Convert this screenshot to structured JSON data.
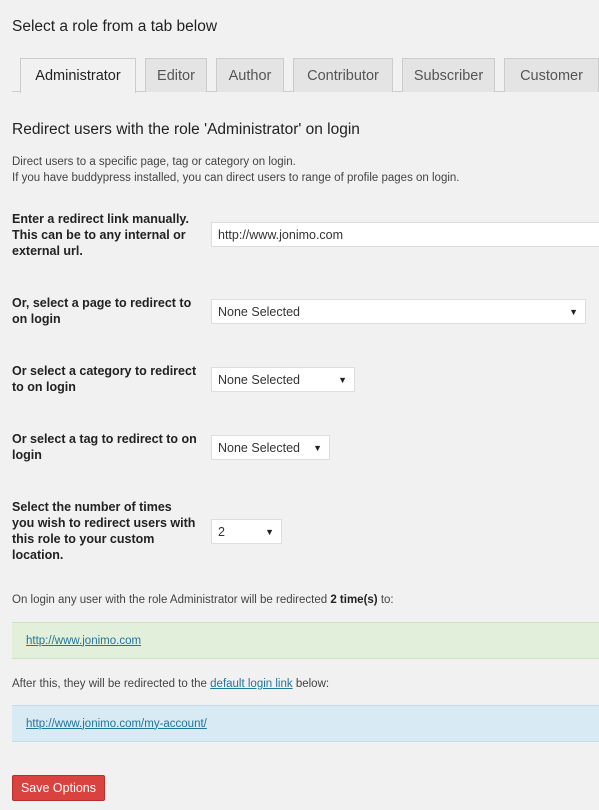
{
  "header": {
    "title": "Select a role from a tab below"
  },
  "tabs": [
    {
      "label": "Administrator",
      "active": true
    },
    {
      "label": "Editor",
      "active": false
    },
    {
      "label": "Author",
      "active": false
    },
    {
      "label": "Contributor",
      "active": false
    },
    {
      "label": "Subscriber",
      "active": false
    },
    {
      "label": "Customer",
      "active": false
    }
  ],
  "section": {
    "title": "Redirect users with the role 'Administrator' on login",
    "desc_line1": "Direct users to a specific page, tag or category on login.",
    "desc_line2": "If you have buddypress installed, you can direct users to range of profile pages on login."
  },
  "form": {
    "redirect_link": {
      "label": "Enter a redirect link manually. This can be to any internal or external url.",
      "value": "http://www.jonimo.com"
    },
    "page": {
      "label": "Or, select a page to redirect to on login",
      "selected": "None Selected"
    },
    "category": {
      "label": "Or select a category to redirect to on login",
      "selected": "None Selected"
    },
    "tag": {
      "label": "Or select a tag to redirect to on login",
      "selected": "None Selected"
    },
    "times": {
      "label": "Select the number of times you wish to redirect users with this role to your custom location.",
      "selected": "2"
    }
  },
  "summary": {
    "line1_prefix": "On login any user with the role Administrator will be redirected ",
    "line1_bold": "2 time(s)",
    "line1_suffix": " to:",
    "redirect_url": "http://www.jonimo.com",
    "line2_prefix": "After this, they will be redirected to the ",
    "line2_link": "default login link",
    "line2_suffix": " below:",
    "default_url": "http://www.jonimo.com/my-account/"
  },
  "actions": {
    "save_label": "Save Options"
  },
  "colors": {
    "background": "#f1f1f1",
    "save_button": "#d9423f",
    "notice_green": "#e2efda",
    "notice_blue": "#d8eaf4",
    "link": "#21759b"
  }
}
